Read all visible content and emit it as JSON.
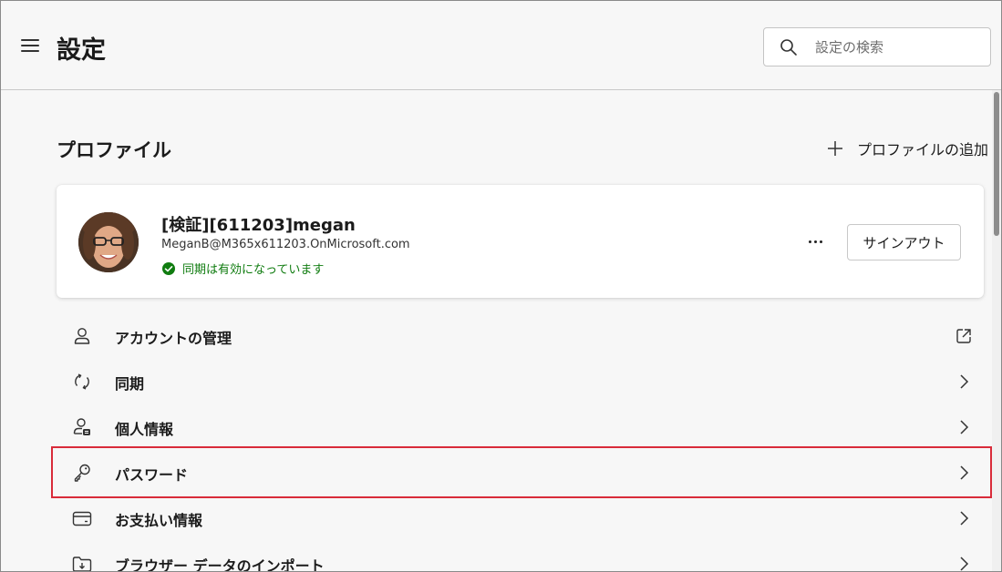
{
  "header": {
    "title": "設定",
    "search": {
      "placeholder": "設定の検索",
      "value": ""
    }
  },
  "profile_section": {
    "title": "プロファイル",
    "add_profile_label": "プロファイルの追加"
  },
  "profile": {
    "name": "[検証][611203]megan",
    "email": "MeganB@M365x611203.OnMicrosoft.com",
    "sync_status": "同期は有効になっています",
    "signout_label": "サインアウト"
  },
  "menu": {
    "items": [
      {
        "label": "アカウントの管理",
        "icon": "person-icon",
        "trail": "external-link-icon"
      },
      {
        "label": "同期",
        "icon": "sync-icon",
        "trail": "chevron-right-icon"
      },
      {
        "label": "個人情報",
        "icon": "personal-info-icon",
        "trail": "chevron-right-icon"
      },
      {
        "label": "パスワード",
        "icon": "key-icon",
        "trail": "chevron-right-icon",
        "highlighted": true
      },
      {
        "label": "お支払い情報",
        "icon": "credit-card-icon",
        "trail": "chevron-right-icon"
      },
      {
        "label": "ブラウザー データのインポート",
        "icon": "import-folder-icon",
        "trail": "chevron-right-icon"
      }
    ]
  },
  "colors": {
    "sync_ok": "#107c10",
    "highlight": "#d92b3a",
    "background": "#f7f7f7"
  }
}
